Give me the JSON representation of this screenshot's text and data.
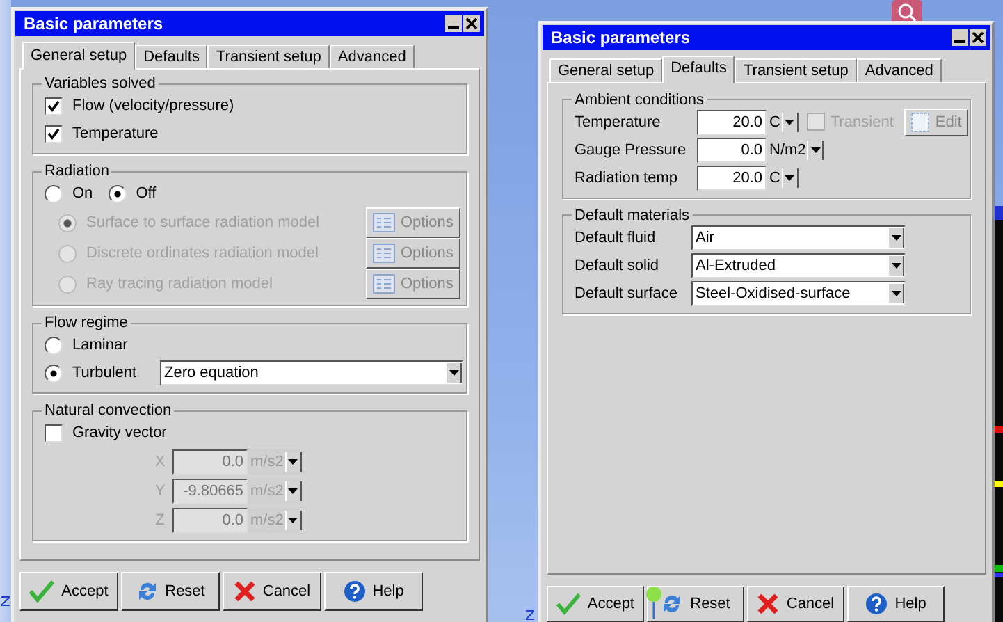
{
  "dialogs": [
    {
      "title": "Basic parameters",
      "tabs": [
        {
          "label": "General setup",
          "selected": true
        },
        {
          "label": "Defaults",
          "selected": false
        },
        {
          "label": "Transient setup",
          "selected": false
        },
        {
          "label": "Advanced",
          "selected": false
        }
      ],
      "sections": [
        {
          "title": "Variables solved",
          "rows": [
            {
              "kind": "checkbox",
              "label": "Flow (velocity/pressure)",
              "checked": true
            },
            {
              "kind": "checkbox",
              "label": "Temperature",
              "checked": true
            }
          ]
        },
        {
          "title": "Radiation",
          "rows": [
            {
              "kind": "radios",
              "options": [
                {
                  "label": "On",
                  "selected": false
                },
                {
                  "label": "Off",
                  "selected": true
                }
              ]
            },
            {
              "kind": "model",
              "label": "Surface to surface radiation model",
              "selected": true,
              "disabled": true,
              "button": "Options"
            },
            {
              "kind": "model",
              "label": "Discrete ordinates radiation model",
              "selected": false,
              "disabled": true,
              "button": "Options"
            },
            {
              "kind": "model",
              "label": "Ray tracing radiation model",
              "selected": false,
              "disabled": true,
              "button": "Options"
            }
          ]
        },
        {
          "title": "Flow regime",
          "rows": [
            {
              "kind": "radio",
              "label": "Laminar",
              "selected": false
            },
            {
              "kind": "radio",
              "label": "Turbulent",
              "selected": true,
              "select": "Zero equation"
            }
          ]
        },
        {
          "title": "Natural convection",
          "rows": [
            {
              "kind": "checkbox",
              "label": "Gravity vector",
              "checked": false
            },
            {
              "kind": "vector",
              "axis": "X",
              "value": "0.0",
              "unit": "m/s2",
              "disabled": true
            },
            {
              "kind": "vector",
              "axis": "Y",
              "value": "-9.80665",
              "unit": "m/s2",
              "disabled": true
            },
            {
              "kind": "vector",
              "axis": "Z",
              "value": "0.0",
              "unit": "m/s2",
              "disabled": true
            }
          ]
        }
      ],
      "buttons": [
        {
          "label": "Accept",
          "kind": "accept"
        },
        {
          "label": "Reset",
          "kind": "reset"
        },
        {
          "label": "Cancel",
          "kind": "cancel"
        },
        {
          "label": "Help",
          "kind": "help"
        }
      ]
    },
    {
      "title": "Basic parameters",
      "tabs": [
        {
          "label": "General setup",
          "selected": false
        },
        {
          "label": "Defaults",
          "selected": true
        },
        {
          "label": "Transient setup",
          "selected": false
        },
        {
          "label": "Advanced",
          "selected": false
        }
      ],
      "sections": [
        {
          "title": "Ambient conditions",
          "rows": [
            {
              "kind": "quantity",
              "label": "Temperature",
              "value": "20.0",
              "unit": "C",
              "transient": {
                "label": "Transient",
                "checked": false,
                "disabled": true
              },
              "button": {
                "label": "Edit",
                "disabled": true
              }
            },
            {
              "kind": "quantity",
              "label": "Gauge Pressure",
              "value": "0.0",
              "unit": "N/m2"
            },
            {
              "kind": "quantity",
              "label": "Radiation temp",
              "value": "20.0",
              "unit": "C"
            }
          ]
        },
        {
          "title": "Default materials",
          "rows": [
            {
              "kind": "dropdown",
              "label": "Default fluid",
              "value": "Air"
            },
            {
              "kind": "dropdown",
              "label": "Default solid",
              "value": "Al-Extruded"
            },
            {
              "kind": "dropdown",
              "label": "Default surface",
              "value": "Steel-Oxidised-surface"
            }
          ]
        }
      ],
      "buttons": [
        {
          "label": "Accept",
          "kind": "accept"
        },
        {
          "label": "Reset",
          "kind": "reset"
        },
        {
          "label": "Cancel",
          "kind": "cancel"
        },
        {
          "label": "Help",
          "kind": "help"
        }
      ]
    }
  ]
}
